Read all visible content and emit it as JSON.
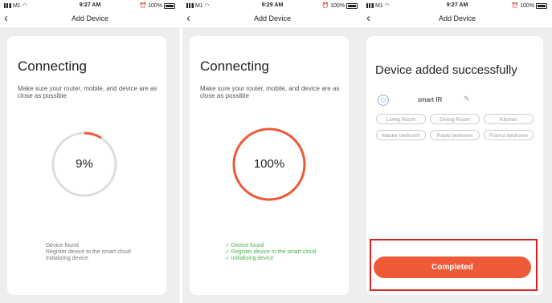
{
  "screens": [
    {
      "status": {
        "carrier": "M1",
        "time": "9:27 AM",
        "battery": "100%"
      },
      "nav": {
        "title": "Add Device"
      },
      "heading": "Connecting",
      "description": "Make sure your router, mobile, and device are as close as possible",
      "progress": {
        "value": 9,
        "label": "9%"
      },
      "steps": [
        "Device found",
        "Register device to the smart cloud",
        "Initializing device"
      ]
    },
    {
      "status": {
        "carrier": "M1",
        "time": "9:29 AM",
        "battery": "100%"
      },
      "nav": {
        "title": "Add Device"
      },
      "heading": "Connecting",
      "description": "Make sure your router, mobile, and device are as close as possible",
      "progress": {
        "value": 100,
        "label": "100%"
      },
      "steps": [
        "✓ Device found",
        "✓ Register device to the smart cloud",
        "✓ Initializing device"
      ]
    },
    {
      "status": {
        "carrier": "M1",
        "time": "9:27 AM",
        "battery": "100%"
      },
      "nav": {
        "title": "Add Device"
      },
      "heading": "Device added successfully",
      "device_name": "smart IR",
      "rooms": [
        "Living Room",
        "Dining Room",
        "Kitchen",
        "Master bedroom",
        "Paolo bedroom",
        "Franco bedroom"
      ],
      "button": "Completed"
    }
  ],
  "colors": {
    "accent": "#ee5a38",
    "success": "#4caf50",
    "track": "#dddddd",
    "highlight": "#e02020"
  }
}
